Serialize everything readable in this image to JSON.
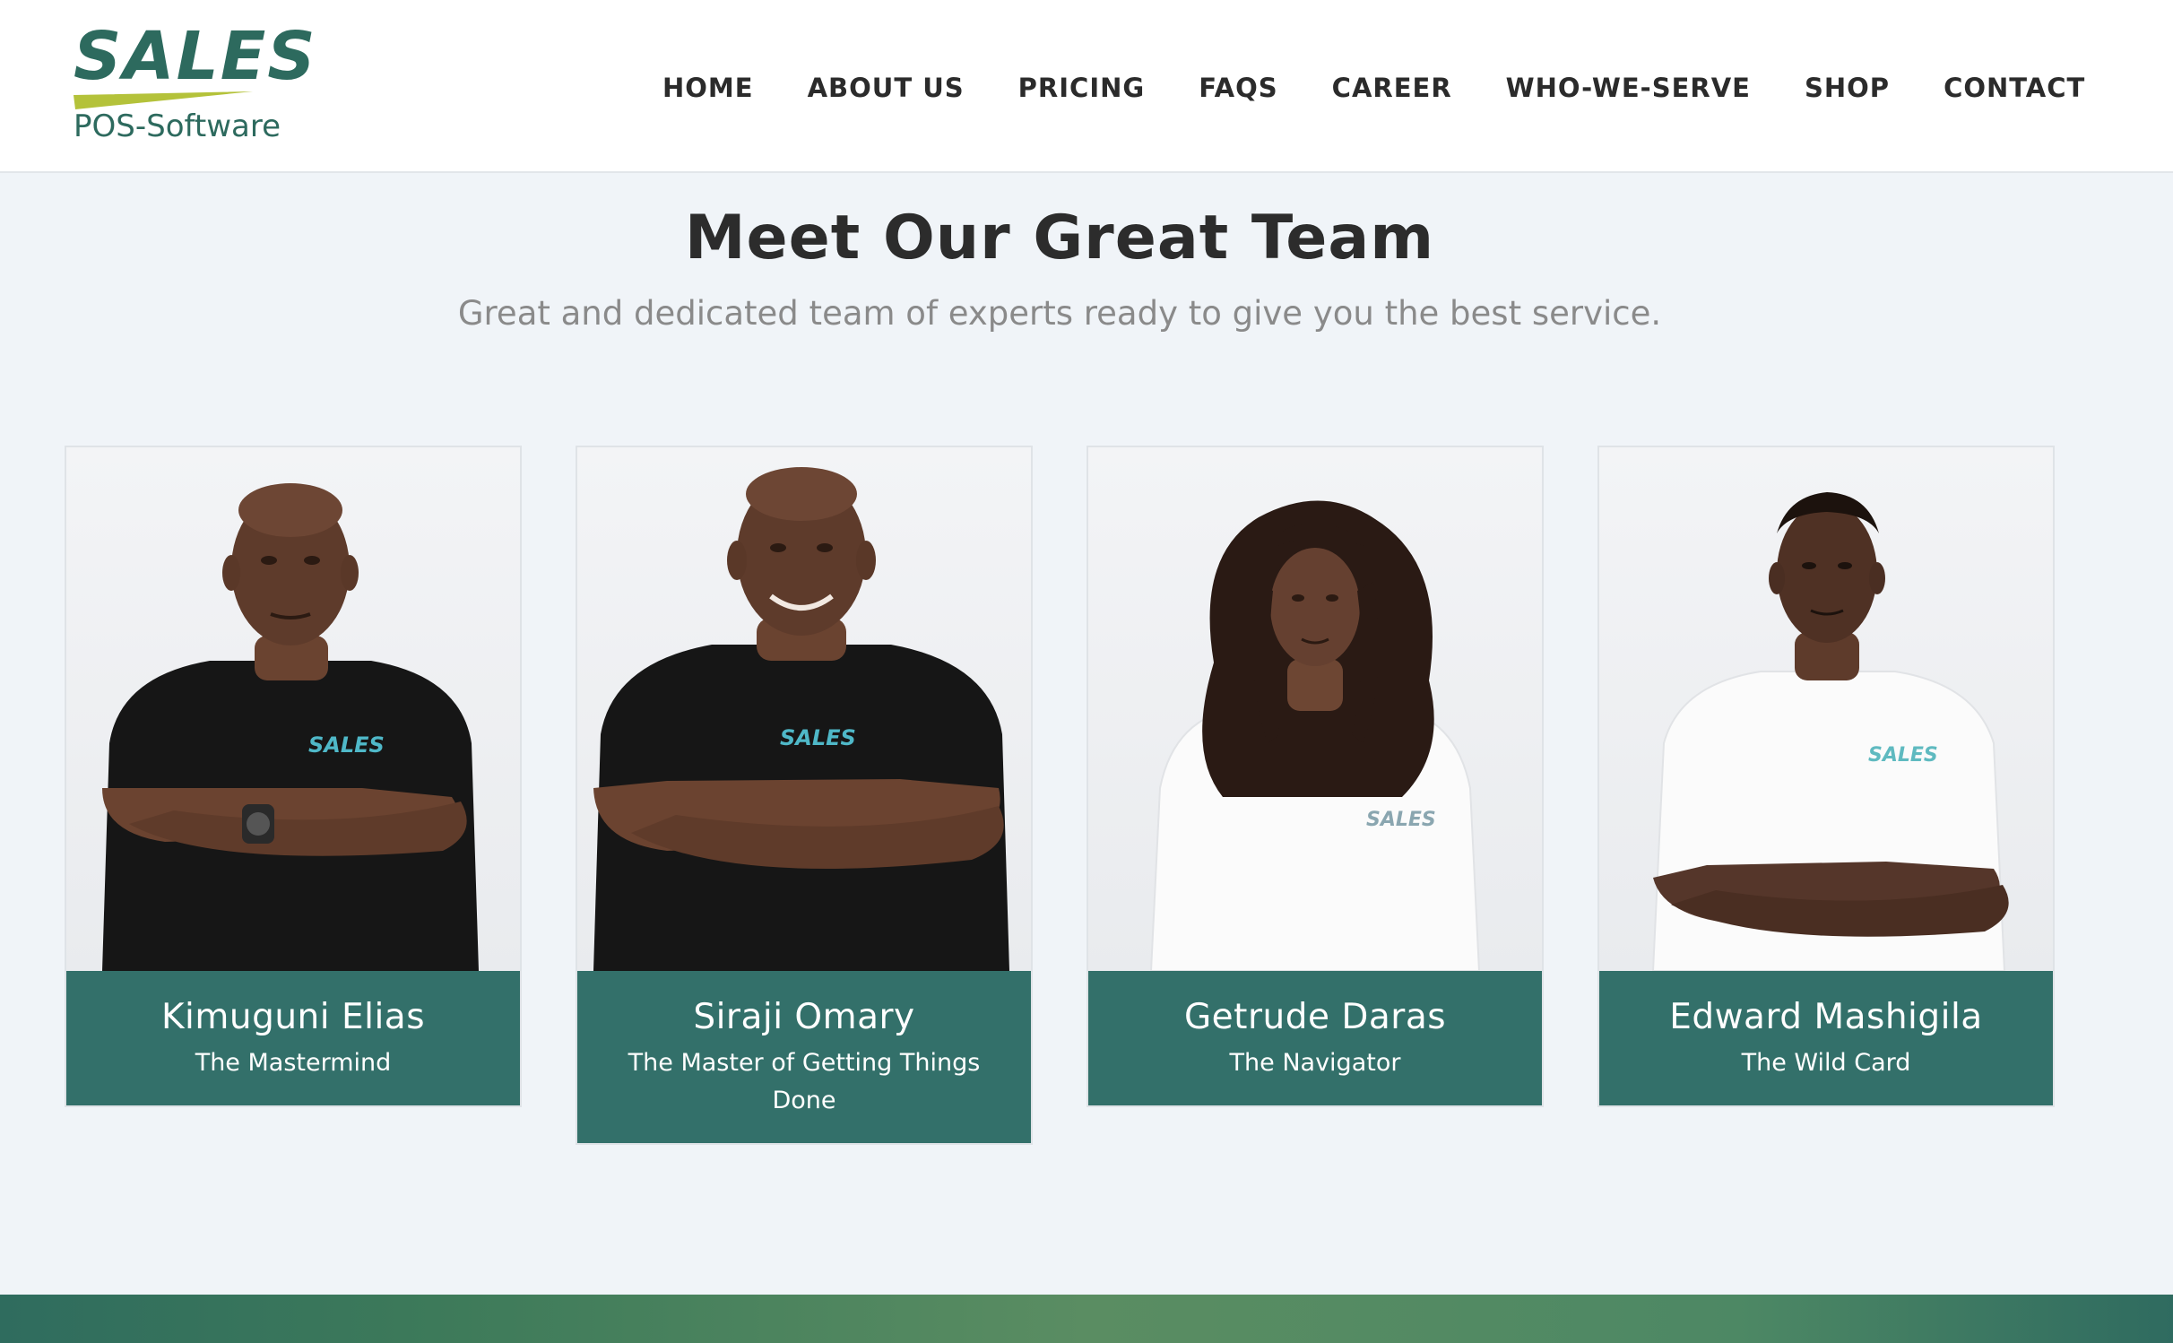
{
  "brand": {
    "word": "SALES",
    "sub": "POS-Software",
    "colors": {
      "primary": "#2d6a5e",
      "accent": "#b4c23a"
    }
  },
  "nav": {
    "items": [
      "HOME",
      "ABOUT US",
      "PRICING",
      "FAQS",
      "CAREER",
      "WHO-WE-SERVE",
      "SHOP",
      "CONTACT"
    ]
  },
  "team": {
    "title": "Meet Our Great Team",
    "subtitle": "Great and dedicated team of experts ready to give you the best service.",
    "members": [
      {
        "name": "Kimuguni Elias",
        "role": "The Mastermind",
        "shirt": "black",
        "shirt_logo": "SALES"
      },
      {
        "name": "Siraji Omary",
        "role": "The Master of Getting Things Done",
        "shirt": "black",
        "shirt_logo": "SALES"
      },
      {
        "name": "Getrude Daras",
        "role": "The Navigator",
        "shirt": "white",
        "shirt_logo": "SALES"
      },
      {
        "name": "Edward Mashigila",
        "role": "The Wild Card",
        "shirt": "white",
        "shirt_logo": "SALES"
      }
    ],
    "caption_color": "#33706a"
  }
}
